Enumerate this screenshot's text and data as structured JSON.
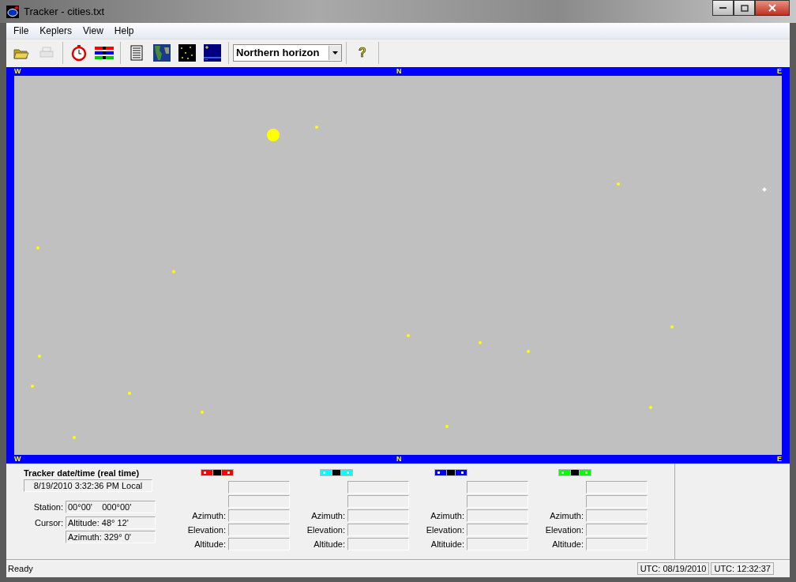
{
  "window": {
    "title": "Tracker - cities.txt"
  },
  "menu": [
    "File",
    "Keplers",
    "View",
    "Help"
  ],
  "toolbar": [
    {
      "kind": "open",
      "disabled": false
    },
    {
      "kind": "print",
      "disabled": true
    },
    {
      "kind": "sep"
    },
    {
      "kind": "timer",
      "disabled": false
    },
    {
      "kind": "bars",
      "disabled": false
    },
    {
      "kind": "sep"
    },
    {
      "kind": "list",
      "disabled": false
    },
    {
      "kind": "map",
      "disabled": false
    },
    {
      "kind": "stars",
      "disabled": false
    },
    {
      "kind": "horizon",
      "disabled": false
    }
  ],
  "view_select": {
    "value": "Northern horizon"
  },
  "help_button": "?",
  "sky": {
    "top": [
      "W",
      "N",
      "E"
    ],
    "bottom": [
      "W",
      "N",
      "E"
    ]
  },
  "tracker": {
    "heading": "Tracker date/time (real time)",
    "datetime": "8/19/2010 3:32:36 PM Local",
    "station_label": "Station:",
    "station": "00°00'    000°00'",
    "cursor_label": "Cursor:",
    "cursor_altitude": "Altitude: 48° 12'",
    "cursor_azimuth": "Azimuth: 329° 0'"
  },
  "satellites": [
    {
      "color": "#ff0000",
      "labels": [
        "Azimuth:",
        "Elevation:",
        "Altitude:"
      ]
    },
    {
      "color": "#00ffff",
      "labels": [
        "Azimuth:",
        "Elevation:",
        "Altitude:"
      ]
    },
    {
      "color": "#0000ff",
      "labels": [
        "Azimuth:",
        "Elevation:",
        "Altituide:"
      ]
    },
    {
      "color": "#00ff00",
      "labels": [
        "Azimuth:",
        "Elevation:",
        "Altitude:"
      ]
    }
  ],
  "status_bar": {
    "message": "Ready",
    "date": "UTC: 08/19/2010",
    "time": "UTC: 12:32:37"
  }
}
